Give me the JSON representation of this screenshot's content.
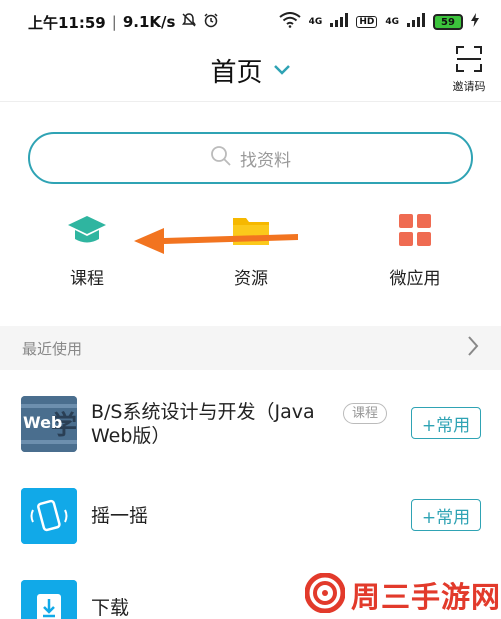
{
  "status_bar": {
    "time": "上午11:59",
    "speed": "9.1K/s",
    "network_1": "4G",
    "hd": "HD",
    "network_2": "4G",
    "battery": "59"
  },
  "header": {
    "title": "首页",
    "invite_label": "邀请码"
  },
  "search": {
    "placeholder": "找资料"
  },
  "quick_entries": [
    {
      "label": "课程",
      "icon": "graduation-cap-icon",
      "color": "#2fb5a0"
    },
    {
      "label": "资源",
      "icon": "folder-icon",
      "color": "#f6b800"
    },
    {
      "label": "微应用",
      "icon": "grid-icon",
      "color": "#ef6b52"
    }
  ],
  "recent": {
    "title": "最近使用",
    "items": [
      {
        "title_line1": "B/S系统设计与开发（Java",
        "title_line2": "Web版）",
        "tag": "课程",
        "button": "+常用",
        "thumb_text": "Web",
        "thumb_color": "#4a6e8e"
      },
      {
        "title": "摇一摇",
        "button": "+常用",
        "thumb_color": "#11a9e8"
      },
      {
        "title": "下载",
        "thumb_color": "#11a9e8"
      }
    ]
  },
  "watermark": {
    "text": "周三手游网"
  },
  "colors": {
    "accent": "#2fa3b4",
    "arrow": "#f27420"
  }
}
